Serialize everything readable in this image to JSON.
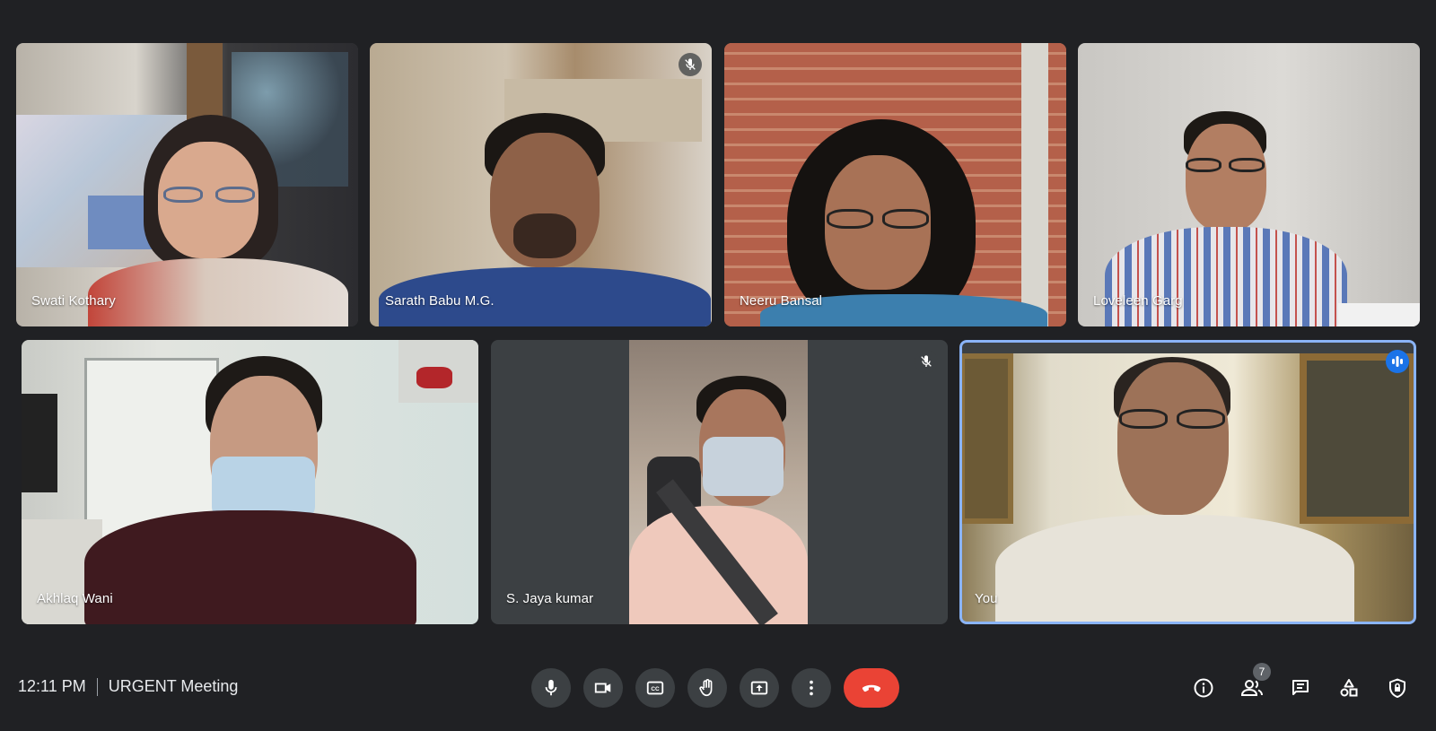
{
  "meeting": {
    "time": "12:11 PM",
    "title": "URGENT Meeting"
  },
  "participants": [
    {
      "name": "Swati Kothary",
      "muted": false
    },
    {
      "name": "Sarath Babu M.G.",
      "muted": true
    },
    {
      "name": "Neeru Bansal",
      "muted": false
    },
    {
      "name": "Loveleen Garg",
      "muted": false
    },
    {
      "name": "Akhlaq Wani",
      "muted": false
    },
    {
      "name": "S. Jaya kumar",
      "muted": true
    },
    {
      "name": "You",
      "muted": false,
      "speaking": true
    }
  ],
  "people_count": "7",
  "colors": {
    "background": "#202124",
    "control": "#3c4043",
    "end_call": "#ea4335",
    "self_border": "#8ab4f8",
    "speaking": "#1a73e8"
  },
  "icons": {
    "controls": [
      "microphone-icon",
      "camera-icon",
      "captions-icon",
      "raise-hand-icon",
      "present-screen-icon",
      "more-options-icon",
      "end-call-icon"
    ],
    "right": [
      "info-icon",
      "people-icon",
      "chat-icon",
      "activities-icon",
      "host-controls-icon"
    ]
  }
}
